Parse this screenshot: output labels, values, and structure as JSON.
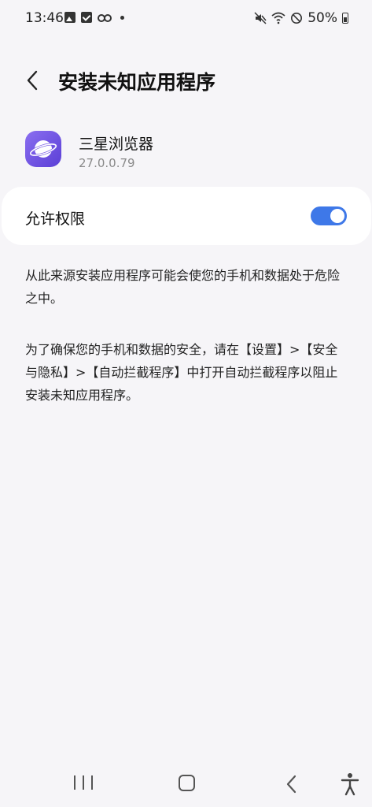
{
  "status_bar": {
    "time": "13:46",
    "battery": "50%",
    "icons_left": [
      "gallery-icon",
      "checkbox-icon",
      "voicemail-icon",
      "dot-icon"
    ],
    "icons_right": [
      "mute-icon",
      "wifi-icon",
      "do-not-disturb-icon",
      "battery-icon"
    ]
  },
  "header": {
    "title": "安装未知应用程序",
    "back_icon": "chevron-left-icon"
  },
  "app": {
    "name": "三星浏览器",
    "version": "27.0.0.79",
    "icon": "samsung-internet-icon"
  },
  "permission": {
    "label": "允许权限",
    "enabled": true,
    "toggle_color": "#3e78e8"
  },
  "description": {
    "paragraph1": "从此来源安装应用程序可能会使您的手机和数据处于危险之中。",
    "paragraph2": "为了确保您的手机和数据的安全，请在【设置】>【安全与隐私】>【自动拦截程序】中打开自动拦截程序以阻止安装未知应用程序。"
  },
  "nav_bar": {
    "icons": [
      "recents-icon",
      "home-icon",
      "back-icon",
      "accessibility-icon"
    ]
  }
}
